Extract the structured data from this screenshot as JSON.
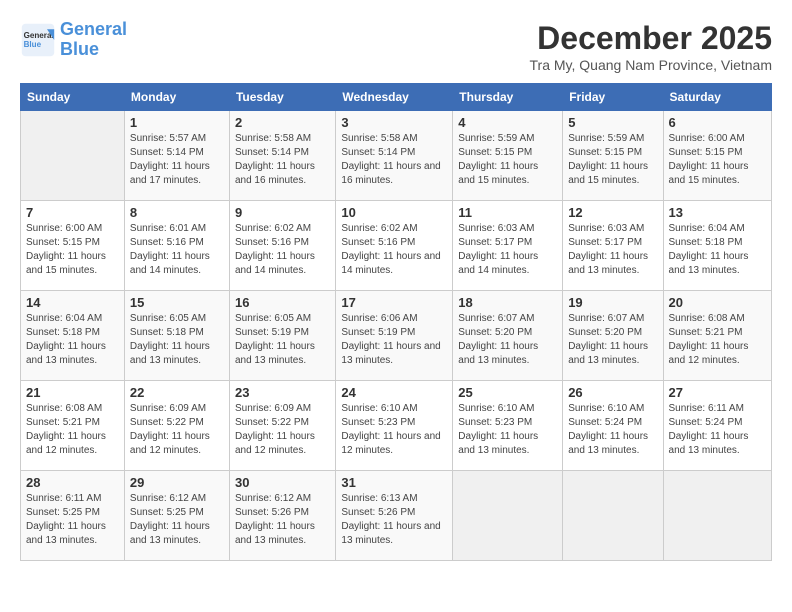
{
  "logo": {
    "line1": "General",
    "line2": "Blue"
  },
  "title": "December 2025",
  "subtitle": "Tra My, Quang Nam Province, Vietnam",
  "days_of_week": [
    "Sunday",
    "Monday",
    "Tuesday",
    "Wednesday",
    "Thursday",
    "Friday",
    "Saturday"
  ],
  "weeks": [
    [
      {
        "day": "",
        "info": ""
      },
      {
        "day": "1",
        "info": "Sunrise: 5:57 AM\nSunset: 5:14 PM\nDaylight: 11 hours and 17 minutes."
      },
      {
        "day": "2",
        "info": "Sunrise: 5:58 AM\nSunset: 5:14 PM\nDaylight: 11 hours and 16 minutes."
      },
      {
        "day": "3",
        "info": "Sunrise: 5:58 AM\nSunset: 5:14 PM\nDaylight: 11 hours and 16 minutes."
      },
      {
        "day": "4",
        "info": "Sunrise: 5:59 AM\nSunset: 5:15 PM\nDaylight: 11 hours and 15 minutes."
      },
      {
        "day": "5",
        "info": "Sunrise: 5:59 AM\nSunset: 5:15 PM\nDaylight: 11 hours and 15 minutes."
      },
      {
        "day": "6",
        "info": "Sunrise: 6:00 AM\nSunset: 5:15 PM\nDaylight: 11 hours and 15 minutes."
      }
    ],
    [
      {
        "day": "7",
        "info": "Sunrise: 6:00 AM\nSunset: 5:15 PM\nDaylight: 11 hours and 15 minutes."
      },
      {
        "day": "8",
        "info": "Sunrise: 6:01 AM\nSunset: 5:16 PM\nDaylight: 11 hours and 14 minutes."
      },
      {
        "day": "9",
        "info": "Sunrise: 6:02 AM\nSunset: 5:16 PM\nDaylight: 11 hours and 14 minutes."
      },
      {
        "day": "10",
        "info": "Sunrise: 6:02 AM\nSunset: 5:16 PM\nDaylight: 11 hours and 14 minutes."
      },
      {
        "day": "11",
        "info": "Sunrise: 6:03 AM\nSunset: 5:17 PM\nDaylight: 11 hours and 14 minutes."
      },
      {
        "day": "12",
        "info": "Sunrise: 6:03 AM\nSunset: 5:17 PM\nDaylight: 11 hours and 13 minutes."
      },
      {
        "day": "13",
        "info": "Sunrise: 6:04 AM\nSunset: 5:18 PM\nDaylight: 11 hours and 13 minutes."
      }
    ],
    [
      {
        "day": "14",
        "info": "Sunrise: 6:04 AM\nSunset: 5:18 PM\nDaylight: 11 hours and 13 minutes."
      },
      {
        "day": "15",
        "info": "Sunrise: 6:05 AM\nSunset: 5:18 PM\nDaylight: 11 hours and 13 minutes."
      },
      {
        "day": "16",
        "info": "Sunrise: 6:05 AM\nSunset: 5:19 PM\nDaylight: 11 hours and 13 minutes."
      },
      {
        "day": "17",
        "info": "Sunrise: 6:06 AM\nSunset: 5:19 PM\nDaylight: 11 hours and 13 minutes."
      },
      {
        "day": "18",
        "info": "Sunrise: 6:07 AM\nSunset: 5:20 PM\nDaylight: 11 hours and 13 minutes."
      },
      {
        "day": "19",
        "info": "Sunrise: 6:07 AM\nSunset: 5:20 PM\nDaylight: 11 hours and 13 minutes."
      },
      {
        "day": "20",
        "info": "Sunrise: 6:08 AM\nSunset: 5:21 PM\nDaylight: 11 hours and 12 minutes."
      }
    ],
    [
      {
        "day": "21",
        "info": "Sunrise: 6:08 AM\nSunset: 5:21 PM\nDaylight: 11 hours and 12 minutes."
      },
      {
        "day": "22",
        "info": "Sunrise: 6:09 AM\nSunset: 5:22 PM\nDaylight: 11 hours and 12 minutes."
      },
      {
        "day": "23",
        "info": "Sunrise: 6:09 AM\nSunset: 5:22 PM\nDaylight: 11 hours and 12 minutes."
      },
      {
        "day": "24",
        "info": "Sunrise: 6:10 AM\nSunset: 5:23 PM\nDaylight: 11 hours and 12 minutes."
      },
      {
        "day": "25",
        "info": "Sunrise: 6:10 AM\nSunset: 5:23 PM\nDaylight: 11 hours and 13 minutes."
      },
      {
        "day": "26",
        "info": "Sunrise: 6:10 AM\nSunset: 5:24 PM\nDaylight: 11 hours and 13 minutes."
      },
      {
        "day": "27",
        "info": "Sunrise: 6:11 AM\nSunset: 5:24 PM\nDaylight: 11 hours and 13 minutes."
      }
    ],
    [
      {
        "day": "28",
        "info": "Sunrise: 6:11 AM\nSunset: 5:25 PM\nDaylight: 11 hours and 13 minutes."
      },
      {
        "day": "29",
        "info": "Sunrise: 6:12 AM\nSunset: 5:25 PM\nDaylight: 11 hours and 13 minutes."
      },
      {
        "day": "30",
        "info": "Sunrise: 6:12 AM\nSunset: 5:26 PM\nDaylight: 11 hours and 13 minutes."
      },
      {
        "day": "31",
        "info": "Sunrise: 6:13 AM\nSunset: 5:26 PM\nDaylight: 11 hours and 13 minutes."
      },
      {
        "day": "",
        "info": ""
      },
      {
        "day": "",
        "info": ""
      },
      {
        "day": "",
        "info": ""
      }
    ]
  ]
}
